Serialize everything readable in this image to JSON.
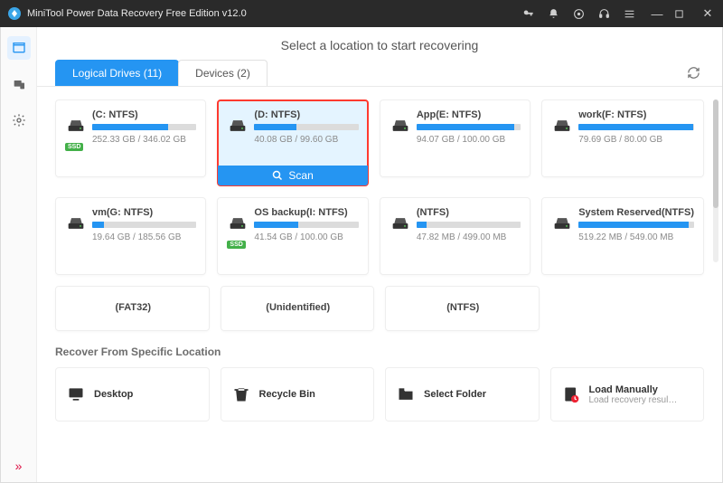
{
  "titlebar": {
    "title": "MiniTool Power Data Recovery Free Edition v12.0"
  },
  "heading": "Select a location to start recovering",
  "tabs": {
    "logical": "Logical Drives (11)",
    "devices": "Devices (2)"
  },
  "scan_label": "Scan",
  "drives": [
    {
      "name": "(C: NTFS)",
      "used": "252.33 GB",
      "total": "346.02 GB",
      "pct": 73,
      "ssd": true,
      "selected": false
    },
    {
      "name": "(D: NTFS)",
      "used": "40.08 GB",
      "total": "99.60 GB",
      "pct": 40,
      "ssd": false,
      "selected": true
    },
    {
      "name": "App(E: NTFS)",
      "used": "94.07 GB",
      "total": "100.00 GB",
      "pct": 94,
      "ssd": false,
      "selected": false
    },
    {
      "name": "work(F: NTFS)",
      "used": "79.69 GB",
      "total": "80.00 GB",
      "pct": 99,
      "ssd": false,
      "selected": false
    },
    {
      "name": "vm(G: NTFS)",
      "used": "19.64 GB",
      "total": "185.56 GB",
      "pct": 11,
      "ssd": false,
      "selected": false
    },
    {
      "name": "OS backup(I: NTFS)",
      "used": "41.54 GB",
      "total": "100.00 GB",
      "pct": 42,
      "ssd": true,
      "selected": false
    },
    {
      "name": "(NTFS)",
      "used": "47.82 MB",
      "total": "499.00 MB",
      "pct": 10,
      "ssd": false,
      "selected": false
    },
    {
      "name": "System Reserved(NTFS)",
      "used": "519.22 MB",
      "total": "549.00 MB",
      "pct": 95,
      "ssd": false,
      "selected": false
    }
  ],
  "drives_simple": [
    {
      "name": "(FAT32)"
    },
    {
      "name": "(Unidentified)"
    },
    {
      "name": "(NTFS)"
    }
  ],
  "locations_title": "Recover From Specific Location",
  "locations": {
    "desktop": "Desktop",
    "recycle": "Recycle Bin",
    "folder": "Select Folder",
    "manual": "Load Manually",
    "manual_sub": "Load recovery result (*..."
  },
  "ssd_badge": "SSD"
}
